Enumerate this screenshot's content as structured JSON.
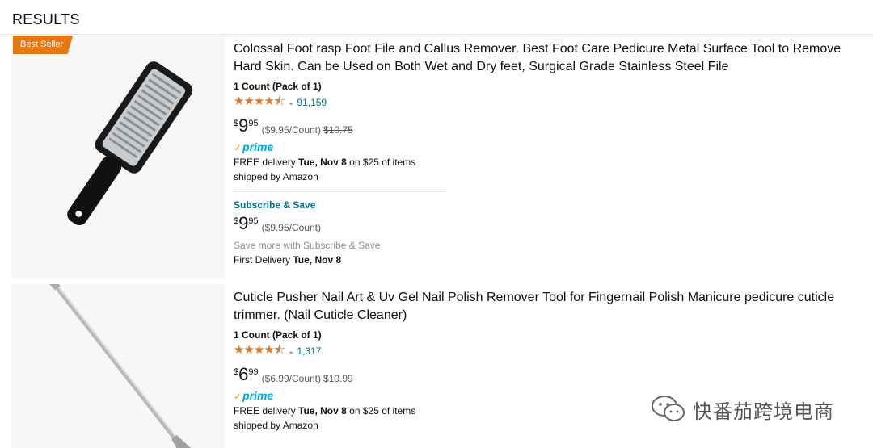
{
  "header": {
    "title": "RESULTS"
  },
  "products": [
    {
      "badge": "Best Seller",
      "title": "Colossal Foot rasp Foot File and Callus Remover. Best Foot Care Pedicure Metal Surface Tool to Remove Hard Skin. Can be Used on Both Wet and Dry feet, Surgical Grade Stainless Steel File",
      "count": "1 Count (Pack of 1)",
      "rating": 4.5,
      "stars": "★★★★⯪",
      "reviews": "91,159",
      "price": {
        "currency": "$",
        "whole": "9",
        "fraction": "95",
        "unit": "($9.95/Count)",
        "list": "$10.75"
      },
      "prime": "prime",
      "delivery": {
        "prefix": "FREE delivery ",
        "date": "Tue, Nov 8",
        "suffix": " on $25 of items"
      },
      "shipped": "shipped by Amazon",
      "subscribe": {
        "title": "Subscribe & Save",
        "price": {
          "currency": "$",
          "whole": "9",
          "fraction": "95",
          "unit": "($9.95/Count)"
        },
        "note": "Save more with Subscribe & Save",
        "first_prefix": "First Delivery ",
        "first_date": "Tue, Nov 8"
      }
    },
    {
      "title": "Cuticle Pusher Nail Art & Uv Gel Nail Polish Remover Tool for Fingernail Polish Manicure pedicure cuticle trimmer. (Nail Cuticle Cleaner)",
      "count": "1 Count (Pack of 1)",
      "rating": 4.5,
      "stars": "★★★★⯪",
      "reviews": "1,317",
      "price": {
        "currency": "$",
        "whole": "6",
        "fraction": "99",
        "unit": "($6.99/Count)",
        "list": "$10.99"
      },
      "prime": "prime",
      "delivery": {
        "prefix": "FREE delivery ",
        "date": "Tue, Nov 8",
        "suffix": " on $25 of items"
      },
      "shipped": "shipped by Amazon"
    }
  ],
  "watermark": {
    "text": "快番茄跨境电商",
    "icon": "wechat-icon"
  },
  "colors": {
    "badge": "#e47911",
    "stars": "#de7921",
    "link": "#007185",
    "prime": "#00a8e1"
  }
}
